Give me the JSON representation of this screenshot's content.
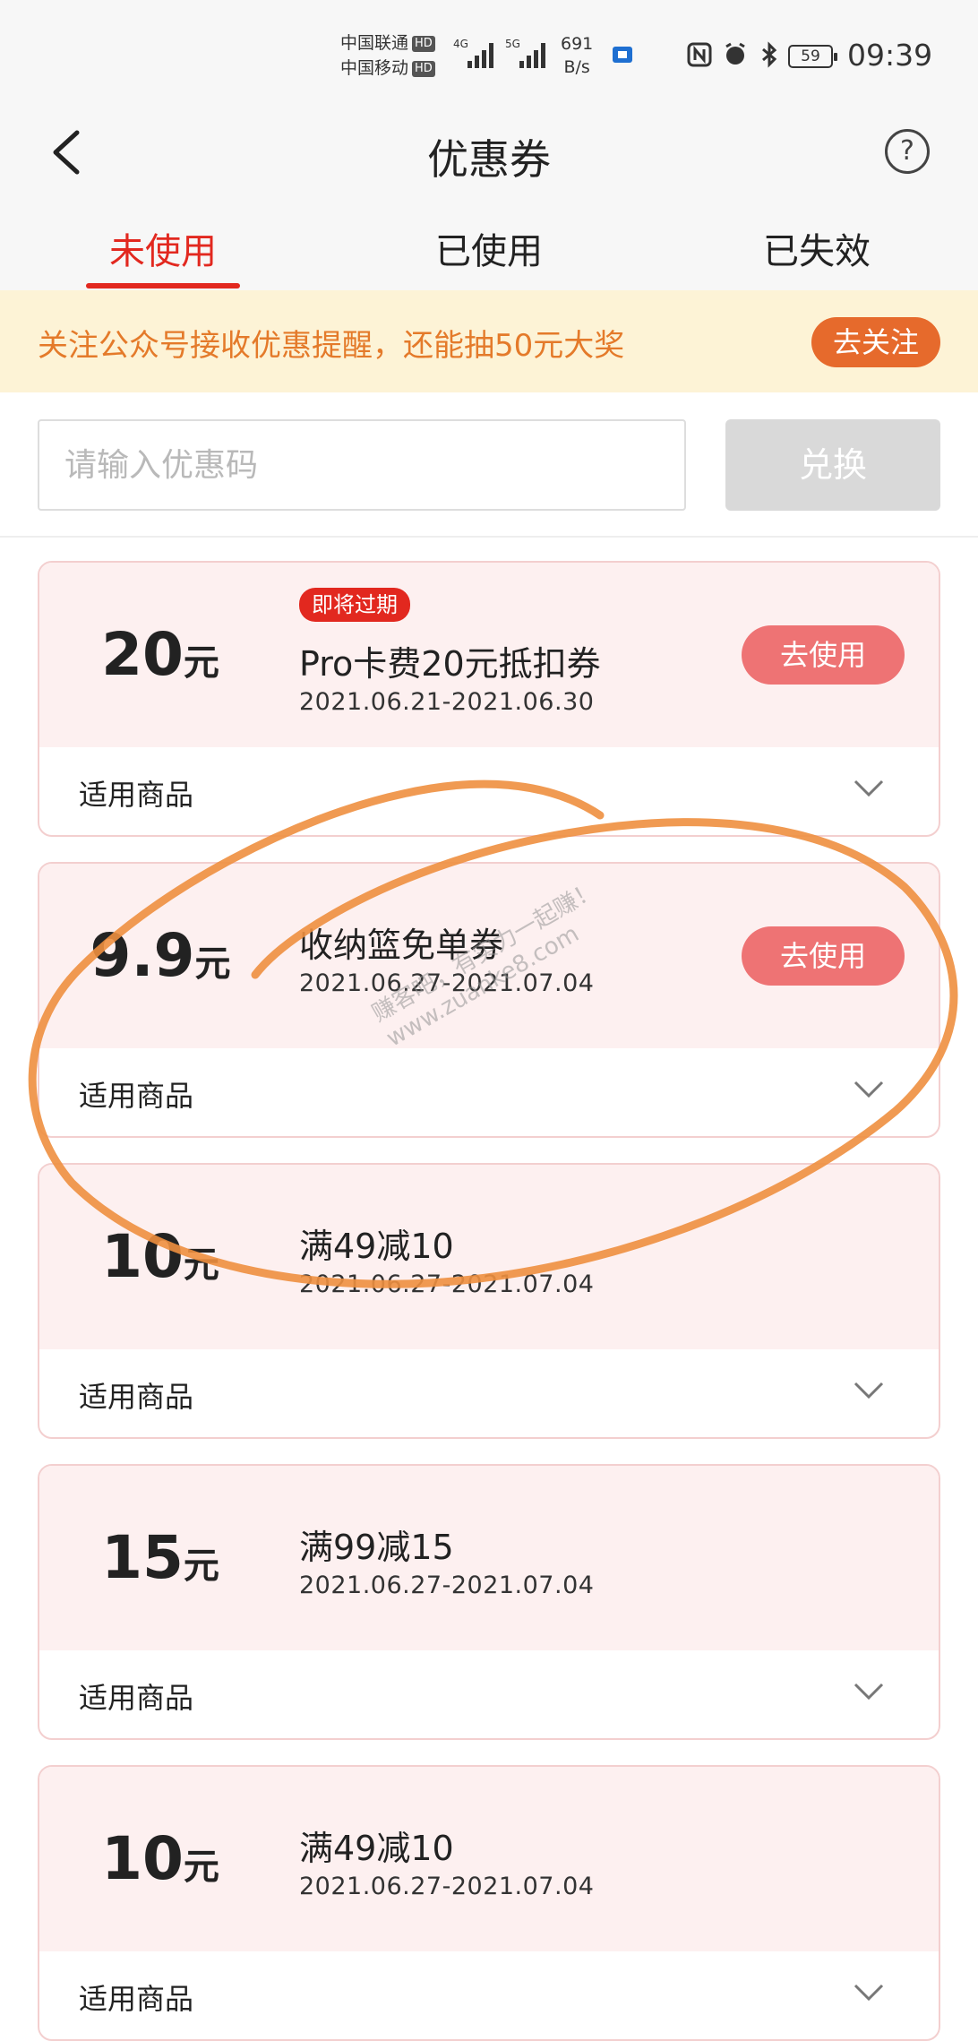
{
  "status_bar": {
    "carrier1": "中国联通",
    "carrier2": "中国移动",
    "hd": "HD",
    "sig1": "4G",
    "sig2": "5G",
    "net_speed_value": "691",
    "net_speed_unit": "B/s",
    "battery": "59",
    "time": "09:39"
  },
  "header": {
    "title": "优惠券",
    "help_icon": "?"
  },
  "tabs": [
    {
      "label": "未使用",
      "active": true
    },
    {
      "label": "已使用",
      "active": false
    },
    {
      "label": "已失效",
      "active": false
    }
  ],
  "banner": {
    "text": "关注公众号接收优惠提醒，还能抽50元大奖",
    "button": "去关注"
  },
  "code_input": {
    "placeholder": "请输入优惠码",
    "value": "",
    "button": "兑换"
  },
  "coupons": [
    {
      "amount": "20",
      "unit": "元",
      "tag": "即将过期",
      "name": "Pro卡费20元抵扣券",
      "date": "2021.06.21-2021.06.30",
      "button": "去使用",
      "footer": "适用商品"
    },
    {
      "amount": "9.9",
      "unit": "元",
      "name": "收纳篮免单券",
      "date": "2021.06.27-2021.07.04",
      "button": "去使用",
      "footer": "适用商品"
    },
    {
      "amount": "10",
      "unit": "元",
      "name": "满49减10",
      "date": "2021.06.27-2021.07.04",
      "footer": "适用商品"
    },
    {
      "amount": "15",
      "unit": "元",
      "name": "满99减15",
      "date": "2021.06.27-2021.07.04",
      "footer": "适用商品"
    },
    {
      "amount": "10",
      "unit": "元",
      "name": "满49减10",
      "date": "2021.06.27-2021.07.04",
      "footer": "适用商品"
    }
  ],
  "watermark": {
    "line1": "赚客吧，有实力一起赚！",
    "line2": "www.zuanke8.com"
  },
  "colors": {
    "accent": "#e2281f",
    "use_button": "#ee7374",
    "banner_bg": "#fdf3d6",
    "banner_text": "#e47a2a",
    "follow_button": "#e66a2c",
    "coupon_bg": "#fdf0f0",
    "annotation": "#ee8f3f"
  }
}
